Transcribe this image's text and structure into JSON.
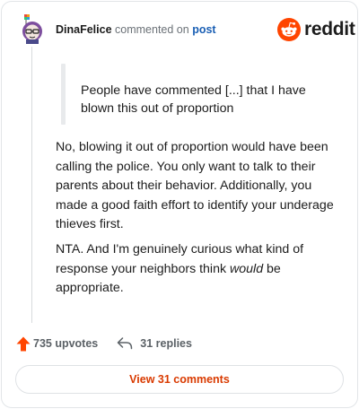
{
  "header": {
    "username": "DinaFelice",
    "commented_on": "commented on",
    "post_link": "post",
    "brand": "reddit"
  },
  "comment": {
    "quote": "People have commented [...] that I have blown this out of proportion",
    "paragraph1": "No, blowing it out of proportion would have been calling the police. You only want to talk to their parents about their behavior. Additionally, you made a good faith effort to identify your underage thieves first.",
    "paragraph2_before": "NTA. And I'm genuinely curious what kind of response your neighbors think ",
    "paragraph2_em": "would",
    "paragraph2_after": " be appropriate."
  },
  "actions": {
    "upvotes": "735 upvotes",
    "replies": "31 replies"
  },
  "footer": {
    "view_comments": "View 31 comments"
  },
  "colors": {
    "accent": "#ff4500",
    "link": "#1a5fb4",
    "button_text": "#d93a00"
  },
  "icons": {
    "avatar": "avatar",
    "brand_logo": "reddit-snoo-icon",
    "upvote": "upvote-arrow-icon",
    "reply": "reply-arrow-icon"
  }
}
